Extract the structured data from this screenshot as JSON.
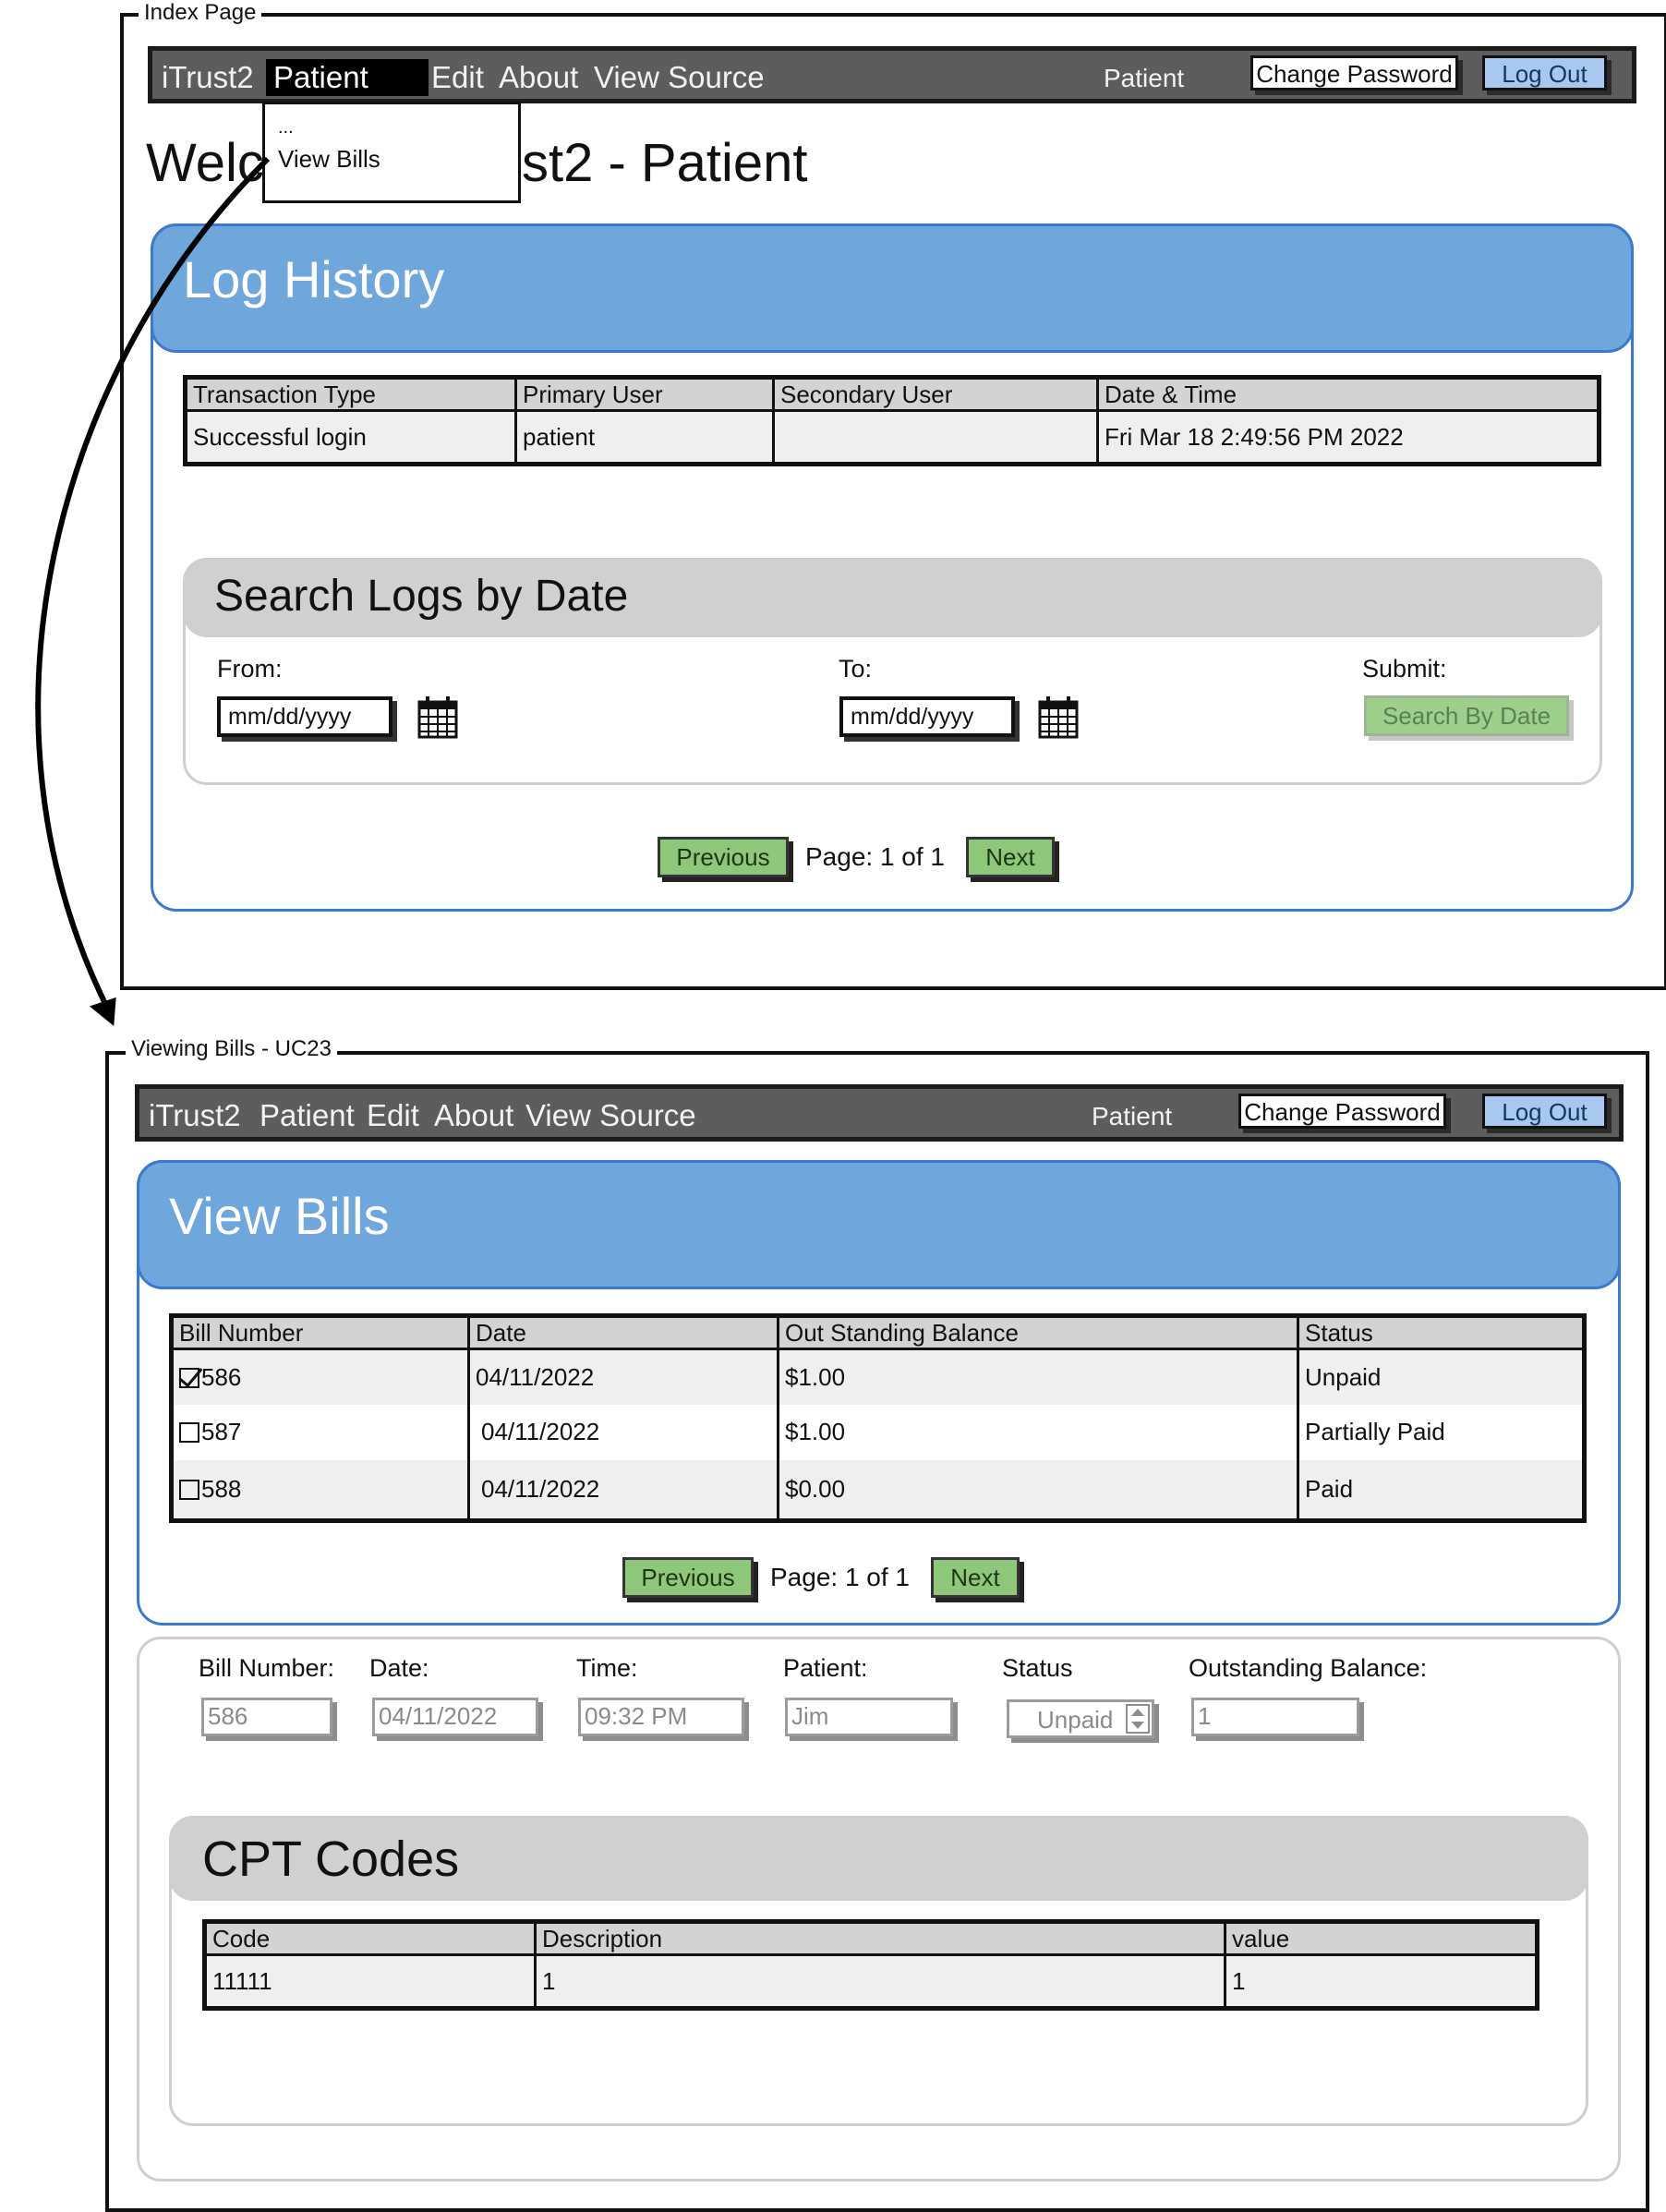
{
  "index_page": {
    "frame_title": "Index Page",
    "nav": {
      "brand": "iTrust2",
      "items": [
        "Patient",
        "Edit",
        "About",
        "View Source"
      ],
      "user": "Patient",
      "change_password": "Change Password",
      "logout": "Log Out"
    },
    "dropdown": {
      "ellipsis": "...",
      "view_bills": "View Bills"
    },
    "welcome_left": "Welc",
    "welcome_right": "st2 - Patient",
    "log_history": {
      "title": "Log History",
      "columns": [
        "Transaction Type",
        "Primary User",
        "Secondary User",
        "Date & Time"
      ],
      "rows": [
        [
          "Successful login",
          "patient",
          "",
          "Fri Mar 18 2:49:56 PM 2022"
        ]
      ]
    },
    "search_logs": {
      "title": "Search Logs by Date",
      "from_label": "From:",
      "to_label": "To:",
      "submit_label": "Submit:",
      "from_placeholder": "mm/dd/yyyy",
      "to_placeholder": "mm/dd/yyyy",
      "search_button": "Search By Date"
    },
    "pager": {
      "previous": "Previous",
      "page": "Page: 1 of 1",
      "next": "Next"
    }
  },
  "viewing_bills": {
    "frame_title": "Viewing Bills - UC23",
    "nav": {
      "brand": "iTrust2",
      "items": [
        "Patient",
        "Edit",
        "About",
        "View Source"
      ],
      "user": "Patient",
      "change_password": "Change Password",
      "logout": "Log Out"
    },
    "view_bills": {
      "title": "View Bills",
      "columns": [
        "Bill Number",
        "Date",
        "Out Standing Balance",
        "Status"
      ],
      "rows": [
        {
          "bill": "586",
          "date": "04/11/2022",
          "balance": "$1.00",
          "status": "Unpaid",
          "checked": true
        },
        {
          "bill": "587",
          "date": "04/11/2022",
          "balance": "$1.00",
          "status": "Partially Paid",
          "checked": false
        },
        {
          "bill": "588",
          "date": "04/11/2022",
          "balance": "$0.00",
          "status": "Paid",
          "checked": false
        }
      ]
    },
    "pager": {
      "previous": "Previous",
      "page": "Page: 1 of 1",
      "next": "Next"
    },
    "detail": {
      "labels": {
        "bill_number": "Bill Number:",
        "date": "Date:",
        "time": "Time:",
        "patient": "Patient:",
        "status": "Status",
        "outstanding": "Outstanding Balance:"
      },
      "values": {
        "bill_number": "586",
        "date": "04/11/2022",
        "time": "09:32 PM",
        "patient": "Jim",
        "status": "Unpaid",
        "outstanding": "1"
      }
    },
    "cpt": {
      "title": "CPT Codes",
      "columns": [
        "Code",
        "Description",
        "value"
      ],
      "rows": [
        [
          "11111",
          "1",
          "1"
        ]
      ]
    }
  }
}
